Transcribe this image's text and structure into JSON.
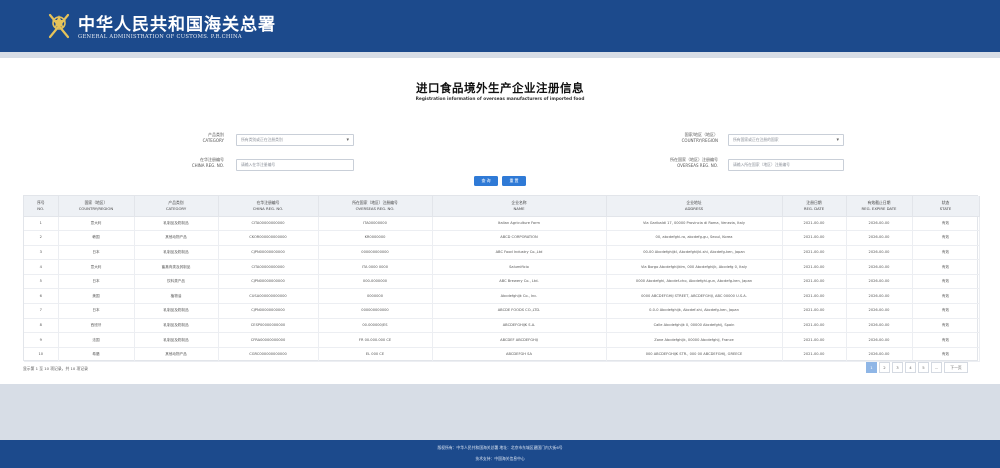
{
  "header": {
    "site_title": "中华人民共和国海关总署",
    "site_subtitle": "GENERAL ADMINISTRATION OF CUSTOMS. P.R.CHINA",
    "emblem_icon": "customs-emblem-icon",
    "background": "#1c4a8c"
  },
  "page": {
    "title": "进口食品境外生产企业注册信息",
    "subtitle": "Registration information of overseas manufacturers of imported food"
  },
  "filters": {
    "category": {
      "label_cn": "产品类别",
      "label_en": "CATEGORY",
      "placeholder": "所有类别或正在注册类别"
    },
    "country": {
      "label_cn": "国家/地区（地区）",
      "label_en": "COUNTRY/REGION",
      "placeholder": "所有国家或正在注册的国家"
    },
    "china_reg_no": {
      "label_cn": "在华注册编号",
      "label_en": "CHINA REG. NO.",
      "placeholder": "请输入在华注册编号"
    },
    "overseas_reg_no": {
      "label_cn": "所在国家（地区）注册编号",
      "label_en": "OVERSEAS REG. NO.",
      "placeholder": "请输入所在国家（地区）注册编号"
    },
    "query_button": "查 询",
    "reset_button": "重 置"
  },
  "table": {
    "columns": [
      {
        "cn": "序号",
        "en": "NO."
      },
      {
        "cn": "国家（地区）",
        "en": "COUNTRY/REGION"
      },
      {
        "cn": "产品类别",
        "en": "CATEGORY"
      },
      {
        "cn": "在华注册编号",
        "en": "CHINA REG. NO."
      },
      {
        "cn": "所在国家（地区）注册编号",
        "en": "OVERSEAS REG. NO."
      },
      {
        "cn": "企业名称",
        "en": "NAME"
      },
      {
        "cn": "企业地址",
        "en": "ADDRESS"
      },
      {
        "cn": "注册日期",
        "en": "REG. DATE"
      },
      {
        "cn": "有效截止日期",
        "en": "REG. EXPIRE DATE"
      },
      {
        "cn": "状态",
        "en": "STATE"
      }
    ],
    "rows": [
      [
        "1",
        "意大利",
        "乳制品及奶制品",
        "CITA00000000000",
        "ITA00000000",
        "Italian Agriculture Farm",
        "Via Garibaldi 17, 00000 Provincia di Roma, Venezia, Italy",
        "2021-00-00",
        "2026-00-00",
        "有效"
      ],
      [
        "2",
        "韩国",
        "其他动物产品",
        "CKOR000000000000",
        "KR0000000",
        "ABCD CORPORATION",
        "00, abcdefghi-ro, abcdefg-gu, Seoul, Korea",
        "2021-00-00",
        "2026-00-00",
        "有效"
      ],
      [
        "3",
        "日本",
        "乳制品及奶制品",
        "CJPN00000000000",
        "000000000000",
        "ABC Food Industry Co.,Ltd",
        "00-00 Abcdefghijkl, Abcdefghijkl-shi, Abcdefg-ken, Japan",
        "2021-00-00",
        "2026-00-00",
        "有效"
      ],
      [
        "4",
        "意大利",
        "畜禽肉类及其制品",
        "CITA00000000000",
        "ITA 0000 0000",
        "Salumificio",
        "Via Borgo Abcdefghijklm, 000 Abcdefghijk, Abcdefg 0, Italy",
        "2021-00-00",
        "2026-00-00",
        "有效"
      ],
      [
        "5",
        "日本",
        "饮料类产品",
        "CJPN00000000000",
        "000-0000000",
        "ABC Brewery Co., Ltd.",
        "0000 Abcdefghi, Abcdef-cho, Abcdefghi-gun, Abcdefg-ken, Japan",
        "2021-00-00",
        "2026-00-00",
        "有效"
      ],
      [
        "6",
        "美国",
        "植物油",
        "CUSA000000000000",
        "0000000",
        "Abcdefghijk Co., Inc.",
        "0000 ABCDEFGHIJ STREET, ABCDEFGHIJ, ABC 00000 U.S.A.",
        "2021-00-00",
        "2026-00-00",
        "有效"
      ],
      [
        "7",
        "日本",
        "乳制品及奶制品",
        "CJPN00000000000",
        "000000000000",
        "ABCDE FOODS CO.,LTD.",
        "0-0-0 Abcdefghijk, Abcdef-shi, Abcdefg-ken, Japan",
        "2021-00-00",
        "2026-00-00",
        "有效"
      ],
      [
        "8",
        "西班牙",
        "乳制品及奶制品",
        "CESP00000000000",
        "00.000000/ES",
        "ABCDEFGHIJK S.A.",
        "Calle Abcdefghijk 0, 00000 Abcdefghij, Spain",
        "2021-00-00",
        "2026-00-00",
        "有效"
      ],
      [
        "9",
        "法国",
        "乳制品及奶制品",
        "CFRA00000000000",
        "FR 00.000.000 CE",
        "ABCDEF ABCDEFGHIJ",
        "Zone Abcdefghijk, 00000 Abcdefghij, France",
        "2021-00-00",
        "2026-00-00",
        "有效"
      ],
      [
        "10",
        "希腊",
        "其他动物产品",
        "CGRC000000000000",
        "EL 000 CE",
        "ABCDEFGH SA",
        "000 ABCDEFGHIJK STR., 000 00 ABCDEFGHIJ, GREECE",
        "2021-00-00",
        "2026-00-00",
        "有效"
      ]
    ]
  },
  "pagination": {
    "info": "显示第 1 至 10 项记录，共 10 项记录",
    "pages": [
      "1",
      "2",
      "3",
      "4",
      "5",
      "..."
    ],
    "next": "下一页"
  },
  "footer": {
    "line1": "版权所有：中华人民共和国海关总署  地址：北京市东城区建国门内大街6号",
    "line2": "技术支持：中国海关信息中心"
  }
}
